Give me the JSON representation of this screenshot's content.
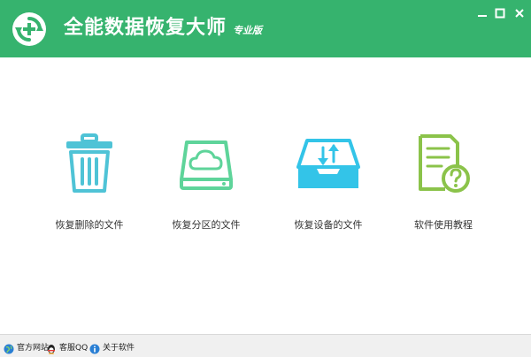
{
  "app": {
    "title": "全能数据恢复大师",
    "edition": "专业版"
  },
  "window_controls": {
    "minimize": "minimize",
    "maximize": "maximize",
    "close": "close"
  },
  "features": [
    {
      "label": "恢复删除的文件",
      "icon": "trash-bin-icon",
      "color": "#4fc3d6"
    },
    {
      "label": "恢复分区的文件",
      "icon": "cloud-drive-icon",
      "color": "#5ed49a"
    },
    {
      "label": "恢复设备的文件",
      "icon": "inbox-transfer-icon",
      "color": "#33c4e8"
    },
    {
      "label": "软件使用教程",
      "icon": "help-document-icon",
      "color": "#8bc34a"
    }
  ],
  "status_bar": {
    "links": [
      {
        "label": "官方网站",
        "icon": "globe-icon"
      },
      {
        "label": "客服QQ",
        "icon": "qq-penguin-icon"
      },
      {
        "label": "关于软件",
        "icon": "info-icon"
      }
    ]
  },
  "colors": {
    "brand_green": "#36b36e",
    "background": "#ffffff",
    "status_bar_bg": "#f0f0f0"
  }
}
